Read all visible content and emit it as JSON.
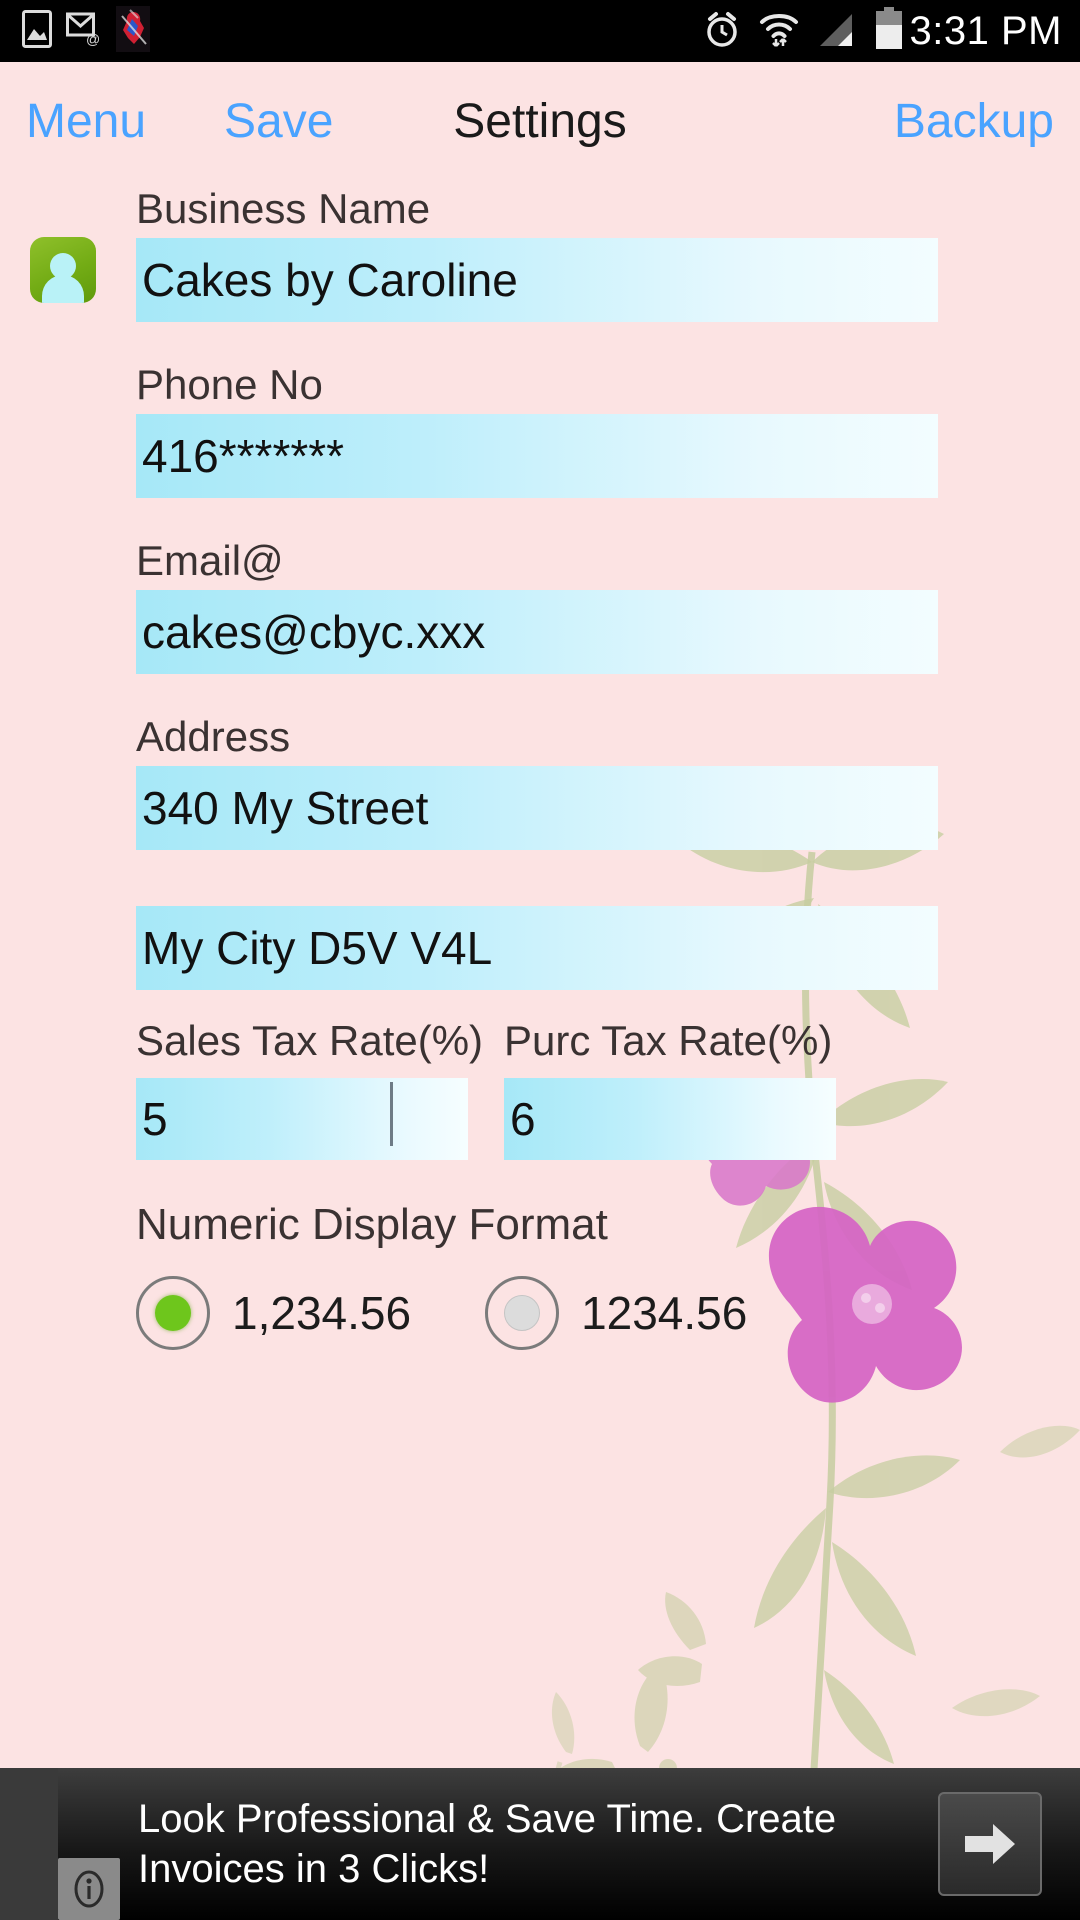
{
  "status_bar": {
    "time": "3:31 PM",
    "left_icons": [
      "photo-icon",
      "email-icon",
      "spiderman-icon"
    ],
    "right_icons": [
      "alarm-icon",
      "wifi-icon",
      "signal-icon",
      "battery-icon"
    ]
  },
  "action_bar": {
    "menu_label": "Menu",
    "save_label": "Save",
    "title": "Settings",
    "backup_label": "Backup",
    "accent_color": "#4aa3ff"
  },
  "form": {
    "business_name": {
      "label": "Business Name",
      "value": "Cakes by Caroline"
    },
    "phone": {
      "label": "Phone No",
      "value": "416*******"
    },
    "email": {
      "label": "Email@",
      "value": "cakes@cbyc.xxx"
    },
    "address": {
      "label": "Address",
      "line1": "340 My Street",
      "line2": "My City D5V V4L"
    },
    "sales_tax": {
      "label": "Sales Tax Rate(%)",
      "value": "5"
    },
    "purc_tax": {
      "label": "Purc Tax Rate(%)",
      "value": "6"
    }
  },
  "numeric_format": {
    "label": "Numeric Display Format",
    "options": [
      {
        "label": "1,234.56",
        "selected": true
      },
      {
        "label": "1234.56",
        "selected": false
      }
    ],
    "selected_color": "#6ec61c"
  },
  "ad": {
    "text": "Look Professional & Save Time. Create Invoices in 3 Clicks!",
    "info_icon": "info-icon",
    "arrow_icon": "arrow-right-icon"
  },
  "theme": {
    "background": "#fce3e3",
    "input_fill_start": "#a6e8f7",
    "input_fill_end": "#f3fdff",
    "text_color": "#3a3232"
  }
}
